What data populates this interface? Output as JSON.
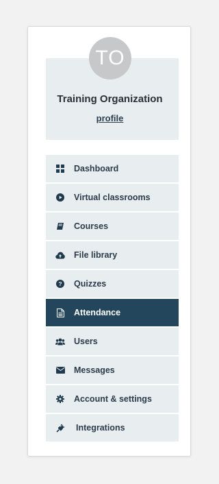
{
  "profile": {
    "avatar_initials": "TO",
    "organization_name": "Training Organization",
    "profile_link": "profile"
  },
  "menu": {
    "active_item": "Attendance",
    "items": [
      {
        "label": "Dashboard",
        "icon": "dashboard-grid-icon"
      },
      {
        "label": "Virtual classrooms",
        "icon": "play-circle-icon"
      },
      {
        "label": "Courses",
        "icon": "book-icon"
      },
      {
        "label": "File library",
        "icon": "cloud-upload-icon"
      },
      {
        "label": "Quizzes",
        "icon": "question-circle-icon"
      },
      {
        "label": "Attendance",
        "icon": "document-icon"
      },
      {
        "label": "Users",
        "icon": "users-icon"
      },
      {
        "label": "Messages",
        "icon": "envelope-icon"
      },
      {
        "label": "Account & settings",
        "icon": "gear-icon"
      },
      {
        "label": "Integrations",
        "icon": "plug-icon"
      }
    ]
  },
  "colors": {
    "active_background": "#23465c",
    "item_background": "#e8eeef",
    "icon_color": "#1f3a4d",
    "avatar_background": "#c6c8ca"
  }
}
